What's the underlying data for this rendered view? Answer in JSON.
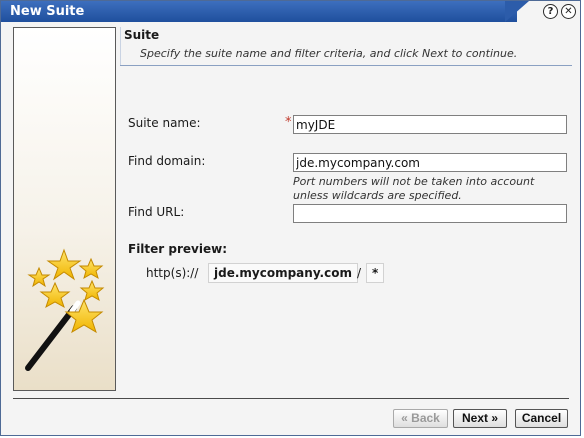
{
  "window": {
    "title": "New Suite",
    "help_symbol": "?",
    "close_symbol": "✕"
  },
  "header": {
    "section_title": "Suite",
    "instructions": "Specify the suite name and filter criteria, and click Next to continue."
  },
  "form": {
    "suite_name_label": "Suite name:",
    "required_marker": "*",
    "suite_name_value": "myJDE",
    "find_domain_label": "Find domain:",
    "find_domain_value": "jde.mycompany.com",
    "domain_hint_line1": "Port numbers will not be taken into account",
    "domain_hint_line2": "unless wildcards are specified.",
    "find_url_label": "Find URL:",
    "find_url_value": ""
  },
  "preview": {
    "label": "Filter preview:",
    "protocol": "http(s)://",
    "domain": "jde.mycompany.com",
    "separator": "/",
    "path": "*"
  },
  "buttons": {
    "back": "« Back",
    "next": "Next »",
    "cancel": "Cancel"
  },
  "colors": {
    "titlebar": "#2c5caa",
    "star": "#f5c518",
    "wand": "#111111"
  },
  "icons": {
    "sidebar_art": "magic-wand-with-stars-icon"
  }
}
